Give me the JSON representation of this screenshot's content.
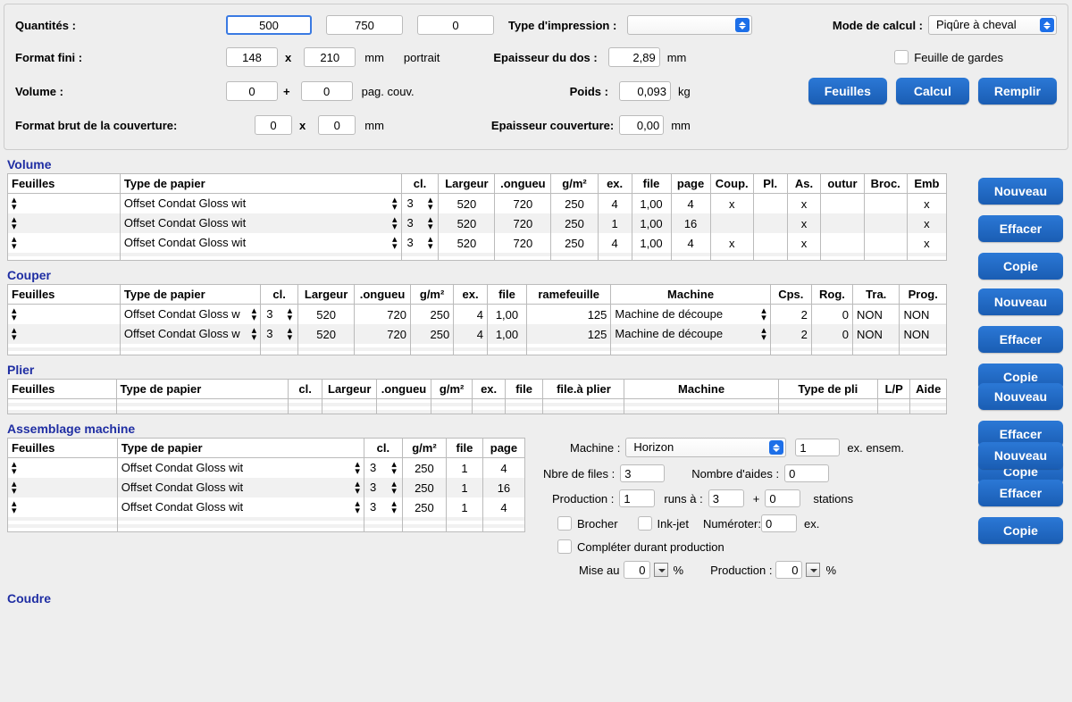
{
  "top": {
    "quantities_label": "Quantités :",
    "q1": "500",
    "q2": "750",
    "q3": "0",
    "print_type_label": "Type d'impression :",
    "print_type_value": "",
    "calc_mode_label": "Mode de calcul :",
    "calc_mode_value": "Piqûre à cheval",
    "format_fini_label": "Format fini :",
    "ff_w": "148",
    "ff_x": "x",
    "ff_h": "210",
    "ff_unit": "mm",
    "ff_orient": "portrait",
    "spine_label": "Epaisseur du dos :",
    "spine_val": "2,89",
    "spine_unit": "mm",
    "guard_checkbox_label": "Feuille de gardes",
    "volume_label": "Volume :",
    "vol_a": "0",
    "vol_plus": "+",
    "vol_b": "0",
    "vol_unit": "pag. couv.",
    "weight_label": "Poids :",
    "weight_val": "0,093",
    "weight_unit": "kg",
    "cover_format_label": "Format brut de la couverture:",
    "cv_w": "0",
    "cv_x": "x",
    "cv_h": "0",
    "cv_unit": "mm",
    "cover_thick_label": "Epaisseur couverture:",
    "cover_thick_val": "0,00",
    "cover_thick_unit": "mm",
    "btn_feuilles": "Feuilles",
    "btn_calcul": "Calcul",
    "btn_remplir": "Remplir"
  },
  "section_titles": {
    "volume": "Volume",
    "couper": "Couper",
    "plier": "Plier",
    "assemblage": "Assemblage machine",
    "coudre": "Coudre"
  },
  "volume_tbl": {
    "headers": [
      "Feuilles",
      "Type de papier",
      "cl.",
      "Largeur",
      ".ongueu",
      "g/m²",
      "ex.",
      "file",
      "page",
      "Coup.",
      "Pl.",
      "As.",
      "outur",
      "Broc.",
      "Emb"
    ],
    "rows": [
      {
        "paper": "Offset Condat Gloss wit",
        "cl": "3",
        "w": "520",
        "l": "720",
        "gsm": "250",
        "ex": "4",
        "file": "1,00",
        "page": "4",
        "coup": "x",
        "pl": "",
        "as": "x",
        "out": "",
        "broc": "",
        "emb": "x"
      },
      {
        "paper": "Offset Condat Gloss wit",
        "cl": "3",
        "w": "520",
        "l": "720",
        "gsm": "250",
        "ex": "1",
        "file": "1,00",
        "page": "16",
        "coup": "",
        "pl": "",
        "as": "x",
        "out": "",
        "broc": "",
        "emb": "x"
      },
      {
        "paper": "Offset Condat Gloss wit",
        "cl": "3",
        "w": "520",
        "l": "720",
        "gsm": "250",
        "ex": "4",
        "file": "1,00",
        "page": "4",
        "coup": "x",
        "pl": "",
        "as": "x",
        "out": "",
        "broc": "",
        "emb": "x"
      }
    ]
  },
  "couper_tbl": {
    "headers": [
      "Feuilles",
      "Type de papier",
      "cl.",
      "Largeur",
      ".ongueu",
      "g/m²",
      "ex.",
      "file",
      "ramefeuille",
      "Machine",
      "Cps.",
      "Rog.",
      "Tra.",
      "Prog."
    ],
    "rows": [
      {
        "paper": "Offset Condat Gloss w",
        "cl": "3",
        "w": "520",
        "l": "720",
        "gsm": "250",
        "ex": "4",
        "file": "1,00",
        "rame": "125",
        "machine": "Machine de découpe",
        "cps": "2",
        "rog": "0",
        "tra": "NON",
        "prog": "NON"
      },
      {
        "paper": "Offset Condat Gloss w",
        "cl": "3",
        "w": "520",
        "l": "720",
        "gsm": "250",
        "ex": "4",
        "file": "1,00",
        "rame": "125",
        "machine": "Machine de découpe",
        "cps": "2",
        "rog": "0",
        "tra": "NON",
        "prog": "NON"
      }
    ]
  },
  "plier_tbl": {
    "headers": [
      "Feuilles",
      "Type de papier",
      "cl.",
      "Largeur",
      ".ongueu",
      "g/m²",
      "ex.",
      "file",
      "file.à plier",
      "Machine",
      "Type de pli",
      "L/P",
      "Aide"
    ]
  },
  "asm_tbl": {
    "headers": [
      "Feuilles",
      "Type de papier",
      "cl.",
      "g/m²",
      "file",
      "page"
    ],
    "rows": [
      {
        "paper": "Offset Condat Gloss wit",
        "cl": "3",
        "gsm": "250",
        "file": "1",
        "page": "4"
      },
      {
        "paper": "Offset Condat Gloss wit",
        "cl": "3",
        "gsm": "250",
        "file": "1",
        "page": "16"
      },
      {
        "paper": "Offset Condat Gloss wit",
        "cl": "3",
        "gsm": "250",
        "file": "1",
        "page": "4"
      }
    ]
  },
  "asm_panel": {
    "machine_label": "Machine :",
    "machine_value": "Horizon",
    "ens_val": "1",
    "ens_suffix": "ex. ensem.",
    "nbfiles_label": "Nbre de files :",
    "nbfiles_val": "3",
    "aides_label": "Nombre d'aides :",
    "aides_val": "0",
    "prod_label": "Production :",
    "prod_a": "1",
    "prod_runs": "runs à :",
    "prod_b": "3",
    "prod_plus": "+",
    "prod_c": "0",
    "prod_stations": "stations",
    "brocher": "Brocher",
    "inkjet": "Ink-jet",
    "num_label": "Numéroter:",
    "num_val": "0",
    "num_ex": "ex.",
    "completer": "Compléter durant production",
    "mise_label": "Mise au",
    "mise_val": "0",
    "pct": "%",
    "prod2_label": "Production :",
    "prod2_val": "0"
  },
  "buttons": {
    "nouveau": "Nouveau",
    "effacer": "Effacer",
    "copie": "Copie"
  }
}
